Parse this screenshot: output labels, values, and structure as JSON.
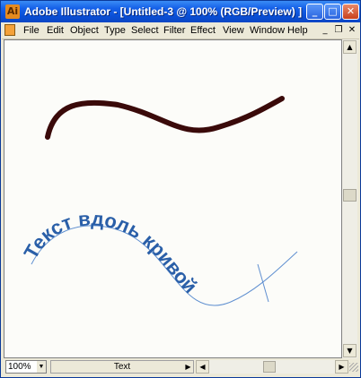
{
  "window": {
    "title": "Adobe Illustrator - [Untitled-3 @ 100% (RGB/Preview) ]",
    "icon": "illustrator-app-icon"
  },
  "window_controls": {
    "minimize": "_",
    "maximize": "□",
    "close": "✕"
  },
  "menubar": {
    "items": [
      "File",
      "Edit",
      "Object",
      "Type",
      "Select",
      "Filter",
      "Effect",
      "View",
      "Window",
      "Help"
    ],
    "mdi_controls": [
      "_",
      "❐",
      "✕"
    ]
  },
  "artwork": {
    "path_text": "Текст вдоль кривой",
    "stroke_color": "#3a0a0a",
    "text_color": "#2a5fa8",
    "guide_color": "#5f8fd0"
  },
  "statusbar": {
    "zoom": "100%",
    "tool_status": "Text"
  },
  "icons": {
    "scroll_up": "arrow-up-icon",
    "scroll_down": "arrow-down-icon",
    "scroll_left": "arrow-left-icon",
    "scroll_right": "arrow-right-icon"
  }
}
